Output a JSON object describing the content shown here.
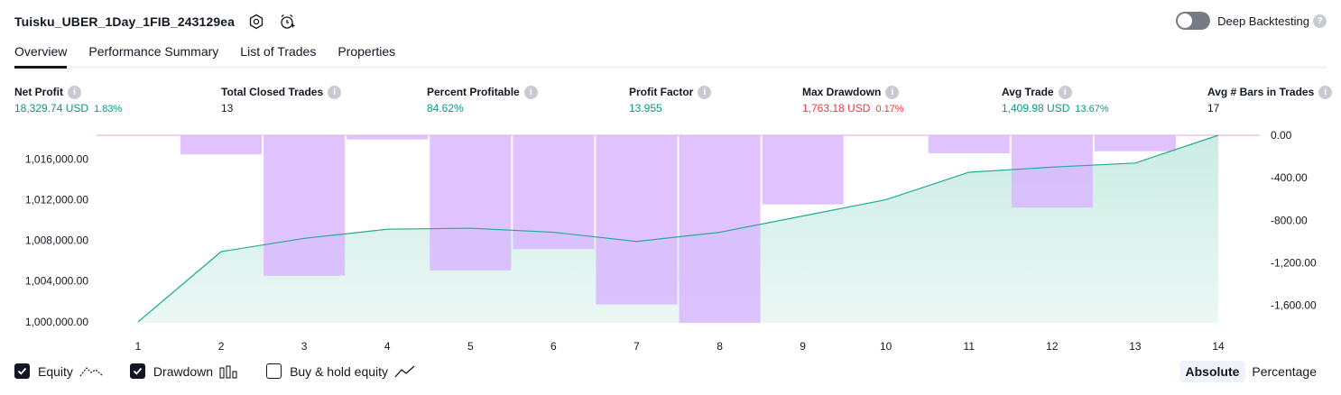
{
  "header": {
    "title": "Tuisku_UBER_1Day_1FIB_243129ea",
    "settings_icon": "gear-icon",
    "alert_icon": "alarm-add-icon",
    "deep_backtesting_label": "Deep Backtesting",
    "deep_backtesting_enabled": false
  },
  "tabs": [
    {
      "label": "Overview",
      "active": true
    },
    {
      "label": "Performance Summary",
      "active": false
    },
    {
      "label": "List of Trades",
      "active": false
    },
    {
      "label": "Properties",
      "active": false
    }
  ],
  "metrics": [
    {
      "label": "Net Profit",
      "value": "18,329.74 USD",
      "pct": "1.83%",
      "color": "green"
    },
    {
      "label": "Total Closed Trades",
      "value": "13",
      "pct": "",
      "color": "dark"
    },
    {
      "label": "Percent Profitable",
      "value": "84.62%",
      "pct": "",
      "color": "green"
    },
    {
      "label": "Profit Factor",
      "value": "13.955",
      "pct": "",
      "color": "green"
    },
    {
      "label": "Max Drawdown",
      "value": "1,763.18 USD",
      "pct": "0.17%",
      "color": "red"
    },
    {
      "label": "Avg Trade",
      "value": "1,409.98 USD",
      "pct": "13.67%",
      "color": "green"
    },
    {
      "label": "Avg # Bars in Trades",
      "value": "17",
      "pct": "",
      "color": "dark"
    }
  ],
  "chart_data": {
    "type": "area",
    "x": [
      1,
      2,
      3,
      4,
      5,
      6,
      7,
      8,
      9,
      10,
      11,
      12,
      13,
      14
    ],
    "series": [
      {
        "name": "Equity",
        "type": "area",
        "axis": "left",
        "values": [
          1000000,
          1006900,
          1008200,
          1009100,
          1009200,
          1008800,
          1007900,
          1008800,
          1010400,
          1012000,
          1014700,
          1015200,
          1015600,
          1018330
        ]
      },
      {
        "name": "Drawdown",
        "type": "bar",
        "axis": "right",
        "values": [
          -180,
          -1320,
          -40,
          -1270,
          -1070,
          -1590,
          -1763.18,
          -650,
          0,
          -170,
          -680,
          -150
        ]
      }
    ],
    "left_axis": {
      "ticks": [
        "1,000,000.00",
        "1,004,000.00",
        "1,008,000.00",
        "1,012,000.00",
        "1,016,000.00"
      ],
      "tick_values": [
        1000000,
        1004000,
        1008000,
        1012000,
        1016000
      ],
      "range": [
        999900,
        1018330
      ]
    },
    "right_axis": {
      "ticks": [
        "0.00",
        "-400.00",
        "-800.00",
        "-1,200.00",
        "-1,600.00"
      ],
      "tick_values": [
        0,
        -400,
        -800,
        -1200,
        -1600
      ],
      "range": [
        -1763.18,
        0
      ]
    },
    "x_ticks": [
      "1",
      "2",
      "3",
      "4",
      "5",
      "6",
      "7",
      "8",
      "9",
      "10",
      "11",
      "12",
      "13",
      "14"
    ],
    "colors": {
      "equity_line": "#22ab94",
      "equity_fill": "#c8ebe2",
      "drawdown": "#d8b4fe",
      "grid": "#f0f3fa",
      "zero_line": "#e1a7c8"
    }
  },
  "legend": {
    "items": [
      {
        "label": "Equity",
        "checked": true,
        "icon": "equity-line-icon"
      },
      {
        "label": "Drawdown",
        "checked": true,
        "icon": "drawdown-bars-icon"
      },
      {
        "label": "Buy & hold equity",
        "checked": false,
        "icon": "buy-hold-line-icon"
      }
    ]
  },
  "scale": {
    "absolute_label": "Absolute",
    "percentage_label": "Percentage",
    "active": "Absolute"
  }
}
